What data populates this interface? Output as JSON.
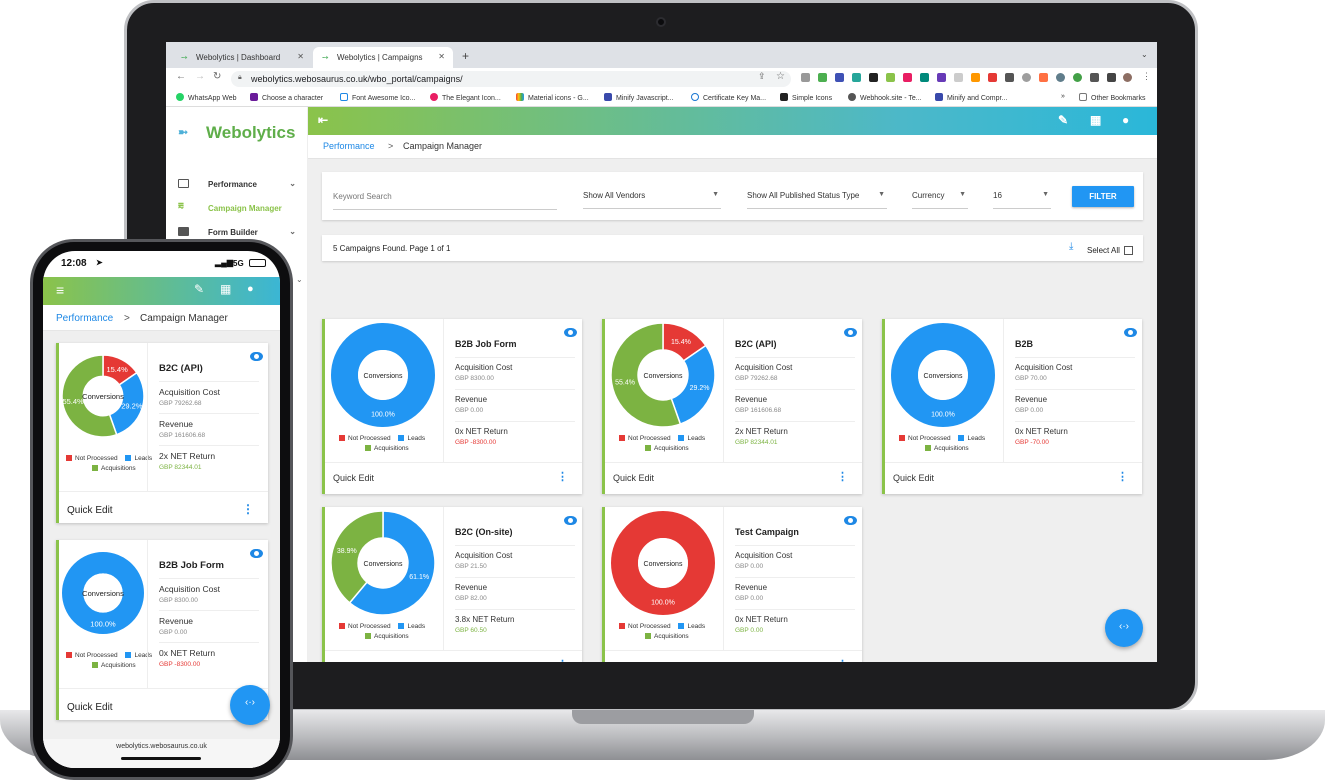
{
  "browser": {
    "tabs": [
      {
        "label": "Webolytics | Dashboard",
        "active": false
      },
      {
        "label": "Webolytics | Campaigns",
        "active": true
      }
    ],
    "url": "webolytics.webosaurus.co.uk/wbo_portal/campaigns/",
    "bookmarks": [
      "WhatsApp Web",
      "Choose a character",
      "Font Awesome Ico...",
      "The Elegant Icon...",
      "Material icons - G...",
      "Minify Javascript...",
      "Certificate Key Ma...",
      "Simple Icons",
      "Webhook.site - Te...",
      "Minify and Compr..."
    ],
    "other_bookmarks": "Other Bookmarks",
    "overflow": "»"
  },
  "app": {
    "brand": "Webolytics",
    "sidebar": [
      {
        "label": "Performance",
        "icon": "dashboard-icon",
        "active": false,
        "expandable": true
      },
      {
        "label": "Campaign Manager",
        "icon": "trending-icon",
        "active": true,
        "expandable": false
      },
      {
        "label": "Form Builder",
        "icon": "form-icon",
        "active": false,
        "expandable": true
      }
    ],
    "breadcrumb": {
      "root": "Performance",
      "sep": ">",
      "current": "Campaign Manager"
    },
    "filters": {
      "search_placeholder": "Keyword Search",
      "vendors": "Show All Vendors",
      "status": "Show All Published Status Type",
      "currency": "Currency",
      "per_page": "16",
      "button": "FILTER"
    },
    "results": {
      "text": "5 Campaigns Found. Page 1 of 1",
      "select_all": "Select All"
    },
    "legend": {
      "not_processed": "Not Processed",
      "leads": "Leads",
      "acquisitions": "Acquisitions"
    },
    "center_label": "Conversions",
    "quick_edit": "Quick Edit",
    "labels": {
      "acq": "Acquisition Cost",
      "rev": "Revenue"
    },
    "colors": {
      "not_processed": "#e53935",
      "leads": "#2196f3",
      "acquisitions": "#7cb342",
      "positive": "#7cb342",
      "negative": "#e53935"
    },
    "campaigns": [
      {
        "title": "B2B Job Form",
        "acq": "GBP 8300.00",
        "rev": "GBP 0.00",
        "ret_label": "0x NET Return",
        "ret": "GBP -8300.00",
        "ret_sign": "negative",
        "slices": [
          0,
          100,
          0
        ],
        "labels": [
          "",
          "100.0%",
          ""
        ]
      },
      {
        "title": "B2C (API)",
        "acq": "GBP 79262.68",
        "rev": "GBP 161606.68",
        "ret_label": "2x NET Return",
        "ret": "GBP 82344.01",
        "ret_sign": "positive",
        "slices": [
          15.4,
          29.2,
          55.4
        ],
        "labels": [
          "15.4%",
          "29.2%",
          "55.4%"
        ]
      },
      {
        "title": "B2B",
        "acq": "GBP 70.00",
        "rev": "GBP 0.00",
        "ret_label": "0x NET Return",
        "ret": "GBP -70.00",
        "ret_sign": "negative",
        "slices": [
          0,
          100,
          0
        ],
        "labels": [
          "",
          "100.0%",
          ""
        ]
      },
      {
        "title": "B2C (On-site)",
        "acq": "GBP 21.50",
        "rev": "GBP 82.00",
        "ret_label": "3.8x NET Return",
        "ret": "GBP 60.50",
        "ret_sign": "positive",
        "slices": [
          0,
          61.1,
          38.9
        ],
        "labels": [
          "",
          "61.1%",
          "38.9%"
        ]
      },
      {
        "title": "Test Campaign",
        "acq": "GBP 0.00",
        "rev": "GBP 0.00",
        "ret_label": "0x NET Return",
        "ret": "GBP 0.00",
        "ret_sign": "positive",
        "slices": [
          100,
          0,
          0
        ],
        "labels": [
          "100.0%",
          "",
          ""
        ]
      }
    ]
  },
  "phone": {
    "time": "12:08",
    "network": "5G",
    "url": "webolytics.webosaurus.co.uk",
    "cards": [
      {
        "title": "B2C (API)",
        "acq": "GBP 79262.68",
        "rev": "GBP 161606.68",
        "ret_label": "2x NET Return",
        "ret": "GBP 82344.01",
        "ret_sign": "positive",
        "slices": [
          15.4,
          29.2,
          55.4
        ],
        "labels": [
          "15.4%",
          "29.2%",
          "55.4%"
        ]
      },
      {
        "title": "B2B Job Form",
        "acq": "GBP 8300.00",
        "rev": "GBP 0.00",
        "ret_label": "0x NET Return",
        "ret": "GBP -8300.00",
        "ret_sign": "negative",
        "slices": [
          0,
          100,
          0
        ],
        "labels": [
          "",
          "100.0%",
          ""
        ]
      }
    ]
  }
}
